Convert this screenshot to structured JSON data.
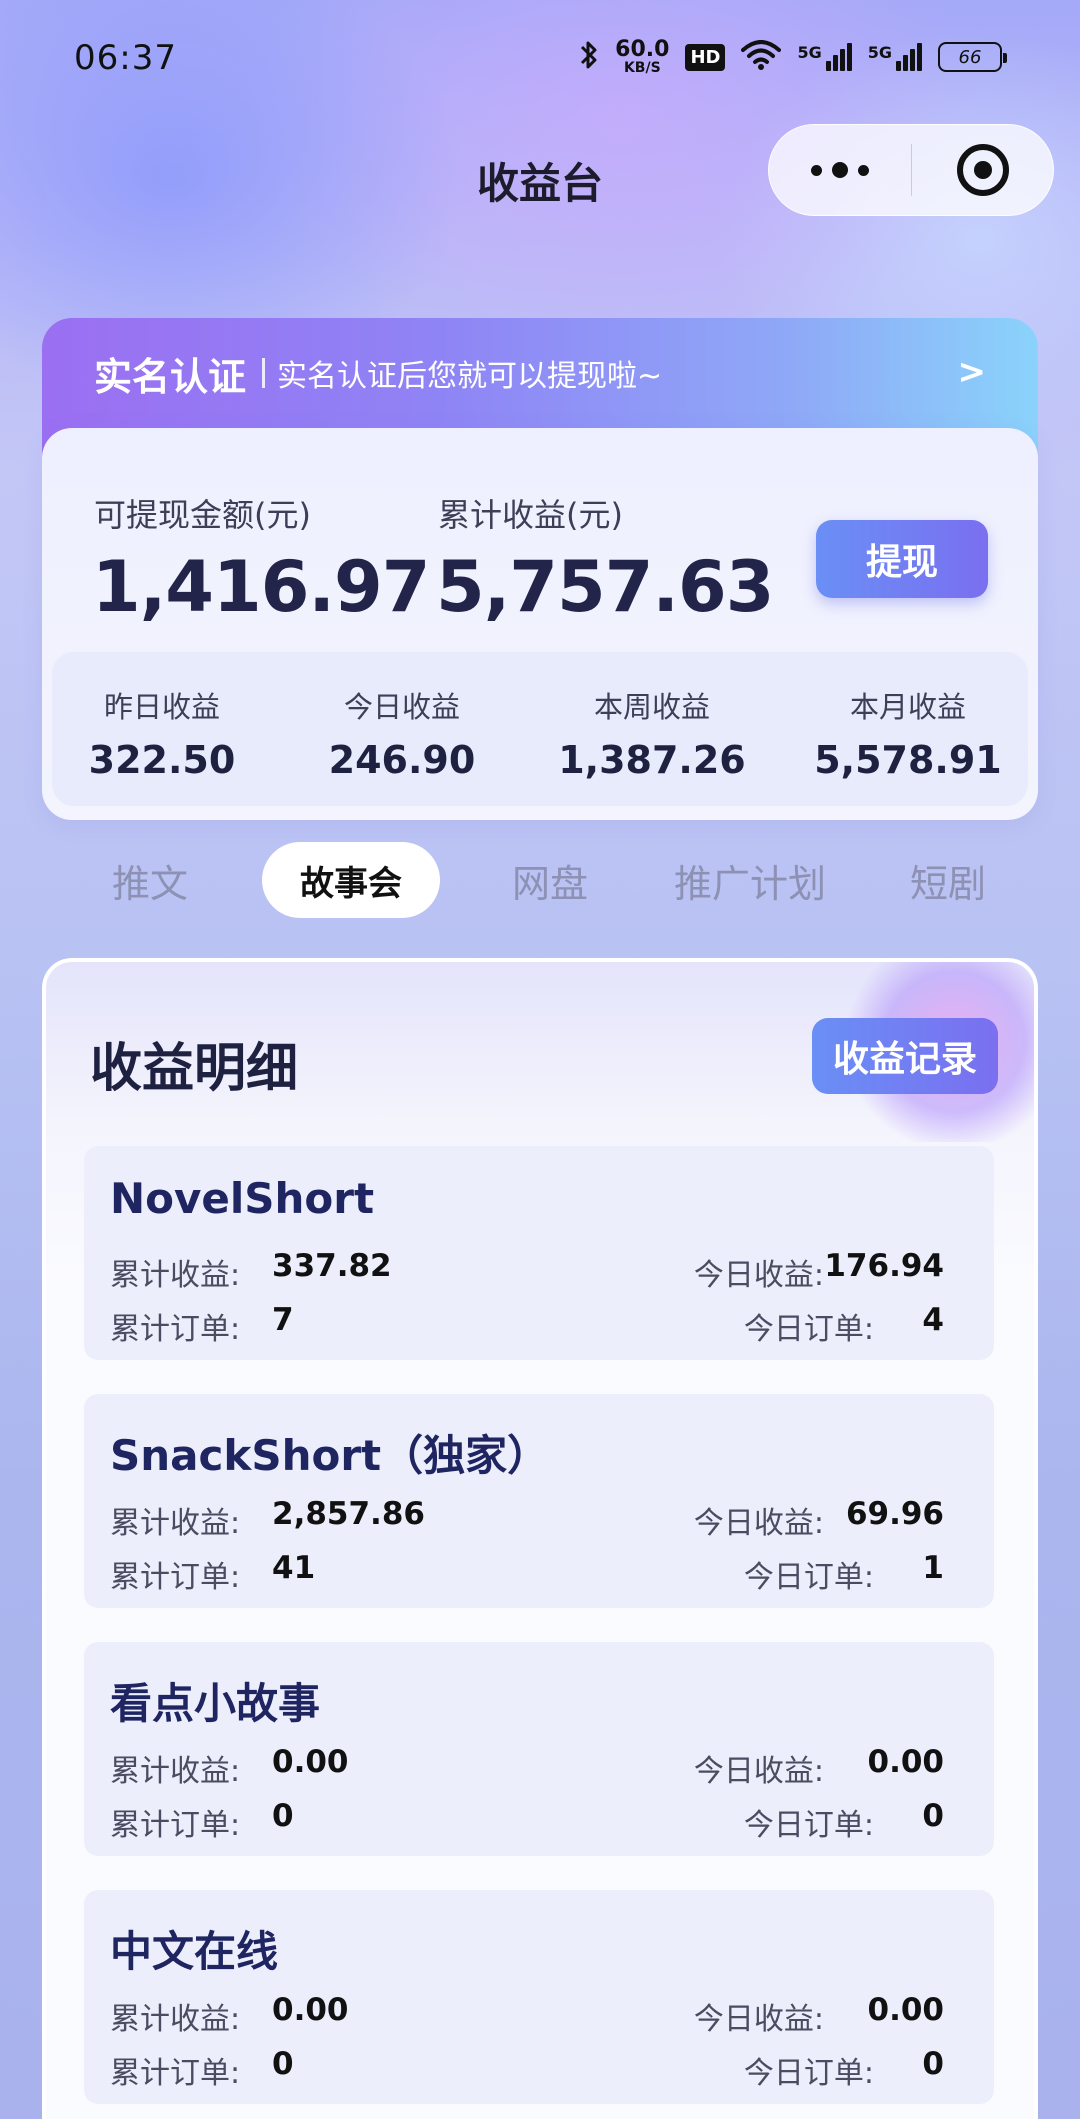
{
  "status_bar": {
    "time": "06:37",
    "net_speed_value": "60.0",
    "net_speed_unit": "KB/S",
    "hd_label": "HD",
    "signal_1": "5G",
    "signal_2": "5G",
    "battery": "66",
    "icons": [
      "bluetooth-icon",
      "hd-icon",
      "wifi-icon",
      "signal-5g-icon",
      "battery-icon"
    ]
  },
  "nav": {
    "title": "收益台"
  },
  "verify_banner": {
    "title": "实名认证",
    "text": "实名认证后您就可以提现啦~",
    "arrow": ">"
  },
  "summary": {
    "withdrawable_label": "可提现金额(元)",
    "withdrawable_value": "1,416.97",
    "total_label": "累计收益(元)",
    "total_value": "5,757.63",
    "withdraw_button": "提现",
    "stats": [
      {
        "label": "昨日收益",
        "value": "322.50"
      },
      {
        "label": "今日收益",
        "value": "246.90"
      },
      {
        "label": "本周收益",
        "value": "1,387.26"
      },
      {
        "label": "本月收益",
        "value": "5,578.91"
      }
    ]
  },
  "tabs": [
    {
      "label": "推文",
      "active": false
    },
    {
      "label": "故事会",
      "active": true
    },
    {
      "label": "网盘",
      "active": false
    },
    {
      "label": "推广计划",
      "active": false
    },
    {
      "label": "短剧",
      "active": false
    }
  ],
  "detail": {
    "title": "收益明细",
    "record_button": "收益记录",
    "labels": {
      "total_income": "累计收益:",
      "total_orders": "累计订单:",
      "today_income": "今日收益:",
      "today_orders": "今日订单:"
    },
    "items": [
      {
        "name": "NovelShort",
        "total_income": "337.82",
        "total_orders": "7",
        "today_income": "176.94",
        "today_orders": "4"
      },
      {
        "name": "SnackShort（独家）",
        "total_income": "2,857.86",
        "total_orders": "41",
        "today_income": "69.96",
        "today_orders": "1"
      },
      {
        "name": "看点小故事",
        "total_income": "0.00",
        "total_orders": "0",
        "today_income": "0.00",
        "today_orders": "0"
      },
      {
        "name": "中文在线",
        "total_income": "0.00",
        "total_orders": "0",
        "today_income": "0.00",
        "today_orders": "0"
      }
    ]
  },
  "colors": {
    "accent_start": "#6a8ff5",
    "accent_end": "#7a6ff0",
    "text_dark": "#1f2140"
  }
}
